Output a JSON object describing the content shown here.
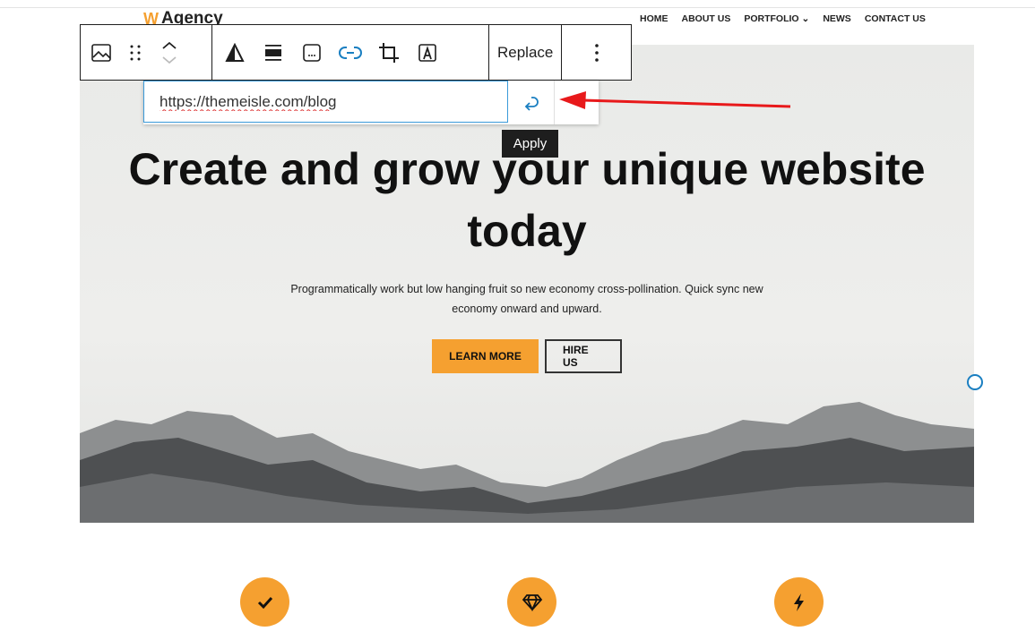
{
  "site": {
    "logo_text": "Agency",
    "nav": [
      "HOME",
      "ABOUT US",
      "PORTFOLIO ⌄",
      "NEWS",
      "CONTACT US"
    ]
  },
  "toolbar": {
    "replace_label": "Replace",
    "icons": [
      "image-icon",
      "drag-handle-icon",
      "move-up-icon",
      "move-down-icon",
      "duotone-icon",
      "align-icon",
      "caption-icon",
      "link-icon",
      "crop-icon",
      "text-overlay-icon",
      "more-options-icon"
    ]
  },
  "link_popover": {
    "url_value": "https://themeisle.com/blog",
    "apply_tooltip": "Apply"
  },
  "hero": {
    "title": "Create and grow your unique website today",
    "subtitle": "Programmatically work but low hanging fruit so new economy cross-pollination. Quick sync new economy onward and upward.",
    "learn_more": "LEARN MORE",
    "hire_us": "HIRE US"
  },
  "features": {
    "icons": [
      "check-icon",
      "diamond-icon",
      "bolt-icon"
    ]
  },
  "colors": {
    "accent": "#f5a030",
    "link_blue": "#3a9ad9",
    "arrow": "#e8191b"
  }
}
